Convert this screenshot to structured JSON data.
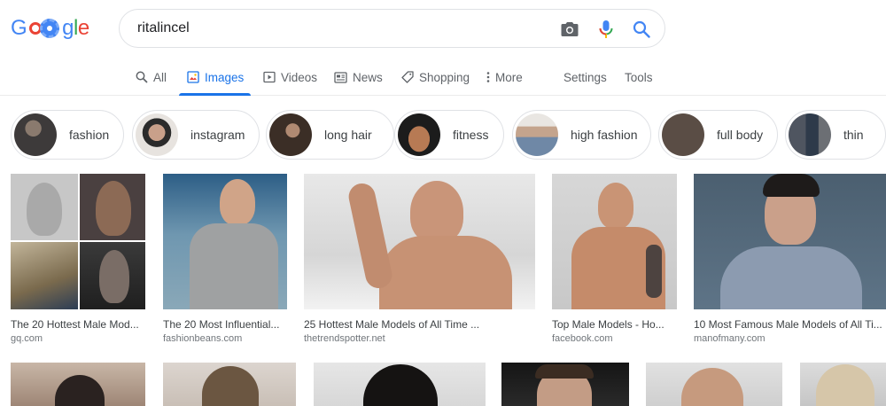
{
  "search": {
    "query": "ritalincel"
  },
  "tabs": [
    {
      "label": "All",
      "icon": "search-icon"
    },
    {
      "label": "Images",
      "icon": "image-icon",
      "active": true
    },
    {
      "label": "Videos",
      "icon": "video-icon"
    },
    {
      "label": "News",
      "icon": "news-icon"
    },
    {
      "label": "Shopping",
      "icon": "tag-icon"
    },
    {
      "label": "More",
      "icon": "more-vert-icon"
    },
    {
      "label": "Settings"
    },
    {
      "label": "Tools"
    }
  ],
  "chips": [
    {
      "label": "fashion"
    },
    {
      "label": "instagram"
    },
    {
      "label": "long hair"
    },
    {
      "label": "fitness"
    },
    {
      "label": "high fashion"
    },
    {
      "label": "full body"
    },
    {
      "label": "thin"
    }
  ],
  "results": [
    {
      "title": "The 20 Hottest Male Mod...",
      "domain": "gq.com"
    },
    {
      "title": "The 20 Most Influential...",
      "domain": "fashionbeans.com"
    },
    {
      "title": "25 Hottest Male Models of All Time ...",
      "domain": "thetrendspotter.net"
    },
    {
      "title": "Top Male Models - Ho...",
      "domain": "facebook.com"
    },
    {
      "title": "10 Most Famous Male Models of All Ti...",
      "domain": "manofmany.com"
    }
  ],
  "colors": {
    "accent": "#1a73e8",
    "text_secondary": "#5f6368",
    "border": "#dfe1e5",
    "domain": "#70757a"
  }
}
